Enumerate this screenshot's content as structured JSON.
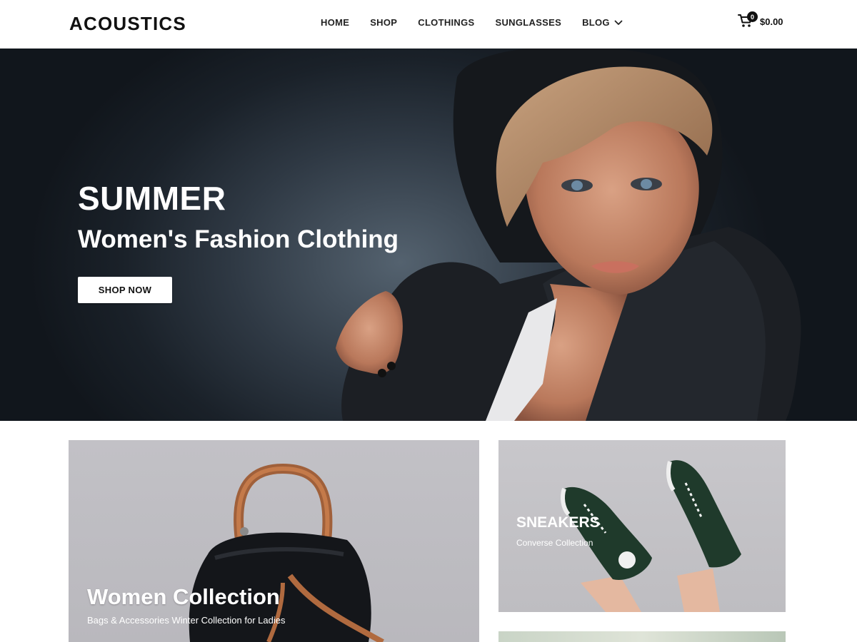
{
  "header": {
    "logo": "ACOUSTICS",
    "nav": [
      {
        "label": "HOME"
      },
      {
        "label": "SHOP"
      },
      {
        "label": "CLOTHINGS"
      },
      {
        "label": "SUNGLASSES"
      },
      {
        "label": "BLOG",
        "has_dropdown": true,
        "dropdown_icon": "chevron-down-icon"
      }
    ],
    "cart": {
      "icon": "cart-icon",
      "count": "0",
      "total": "$0.00"
    }
  },
  "hero": {
    "title": "SUMMER",
    "subtitle": "Women's Fashion Clothing",
    "button": "SHOP NOW"
  },
  "collections": [
    {
      "title": "Women Collection",
      "subtitle": "Bags & Accessories Winter Collection for Ladies"
    },
    {
      "title": "SNEAKERS",
      "subtitle": "Converse Collection"
    }
  ],
  "colors": {
    "accent": "#111111",
    "hero_dark": "#1a2129",
    "card_bg": "#c2c1c6"
  }
}
